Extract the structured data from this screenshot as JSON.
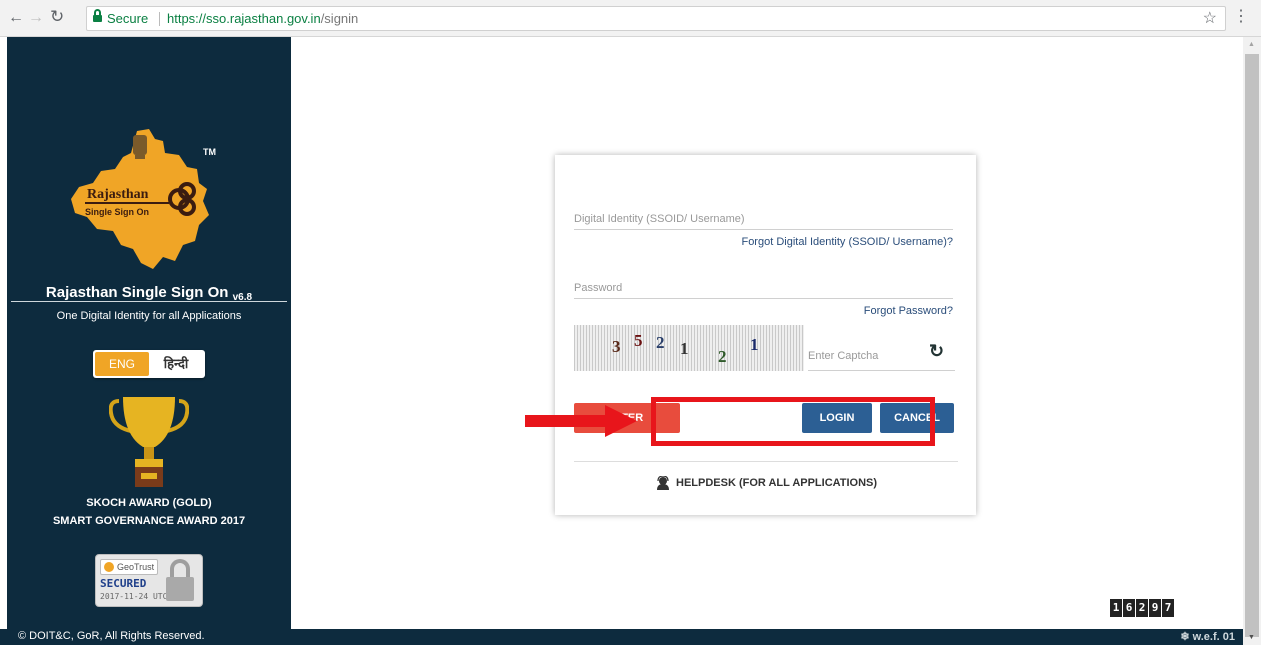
{
  "browser": {
    "secure_label": "Secure",
    "url_host": "https://sso.rajasthan.gov.in",
    "url_path": "/signin"
  },
  "sidebar": {
    "logo_text_main": "Rajasthan",
    "logo_text_sub": "Single Sign On",
    "tm": "TM",
    "app_name": "Rajasthan Single Sign On",
    "version": "v6.8",
    "tagline": "One Digital Identity for all Applications",
    "lang_eng": "ENG",
    "lang_hindi": "हिन्दी",
    "award_line1": "SKOCH AWARD (GOLD)",
    "award_line2": "SMART GOVERNANCE AWARD 2017",
    "geotrust_brand": "GeoTrust",
    "geotrust_secured": "SECURED",
    "geotrust_date": "2017-11-24 UTC"
  },
  "footer": {
    "copyright": "© DOIT&C, GoR, All Rights Reserved.",
    "wef": "❄ w.e.f. 01"
  },
  "counter": {
    "digits": [
      "1",
      "6",
      "2",
      "9",
      "7"
    ]
  },
  "login": {
    "ssoid_placeholder": "Digital Identity (SSOID/ Username)",
    "forgot_id": "Forgot Digital Identity (SSOID/ Username)?",
    "password_placeholder": "Password",
    "forgot_password": "Forgot Password?",
    "captcha_chars": [
      "3",
      "5",
      "2",
      "1",
      "2",
      "1"
    ],
    "captcha_placeholder": "Enter Captcha",
    "register_label": "ISTER",
    "login_label": "LOGIN",
    "cancel_label": "CANCEL",
    "helpdesk": "HELPDESK (FOR ALL APPLICATIONS)"
  },
  "colors": {
    "sidebar_bg": "#0d2b3e",
    "accent_orange": "#f0a526",
    "register_red": "#e84c3d",
    "button_blue": "#2c5f94",
    "annotation_red": "#e8151b",
    "secure_green": "#0b8043"
  }
}
